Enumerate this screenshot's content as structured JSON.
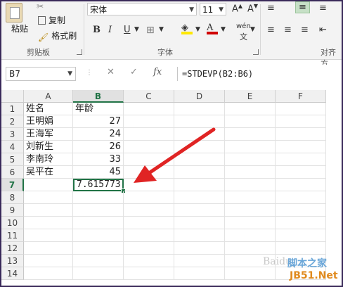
{
  "clipboard": {
    "paste": "粘贴",
    "copy": "复制",
    "format_painter": "格式刷",
    "group_label": "剪贴板"
  },
  "font": {
    "name": "宋体",
    "size": "11",
    "group_label": "字体",
    "bold": "B",
    "italic": "I",
    "underline": "U",
    "phonetic": "wén"
  },
  "alignment": {
    "group_label": "对齐方"
  },
  "formula_bar": {
    "name_box": "B7",
    "fx": "fx",
    "formula": "=STDEVP(B2:B6)"
  },
  "columns": [
    "A",
    "B",
    "C",
    "D",
    "E",
    "F"
  ],
  "rows": [
    "1",
    "2",
    "3",
    "4",
    "5",
    "6",
    "7",
    "8",
    "9",
    "10",
    "11",
    "12",
    "13",
    "14"
  ],
  "cells": {
    "A1": "姓名",
    "B1": "年龄",
    "A2": "王明娟",
    "B2": "27",
    "A3": "王海军",
    "B3": "24",
    "A4": "刘新生",
    "B4": "26",
    "A5": "李南玲",
    "B5": "33",
    "A6": "吴平在",
    "B6": "45",
    "B7": "7.615773"
  },
  "active_cell": "B7",
  "colors": {
    "accent": "#217346",
    "arrow": "#e02424",
    "font_color": "#d00000",
    "highlight": "#ffe800"
  },
  "watermark": {
    "text": "Baidu",
    "site_name": "脚本之家",
    "site_url": "JB51.Net"
  }
}
